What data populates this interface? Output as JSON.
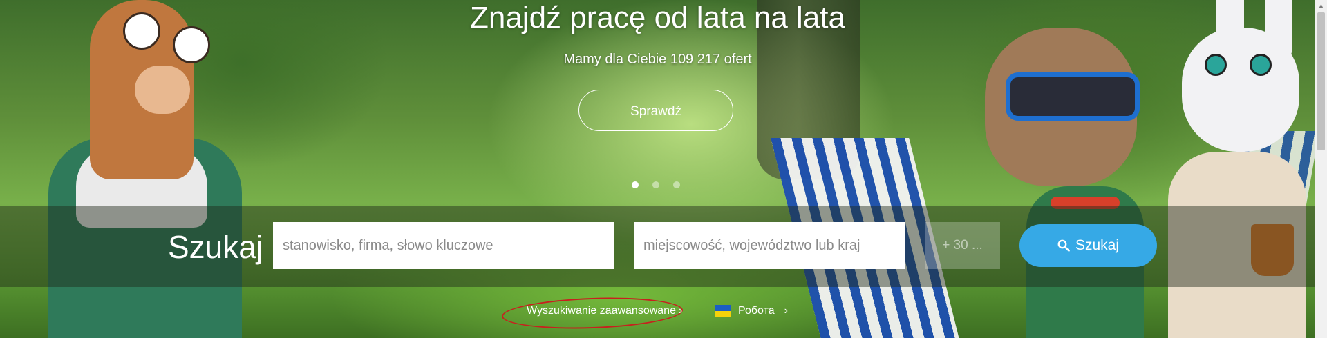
{
  "hero": {
    "headline": "Znajdź pracę od lata na lata",
    "subline": "Mamy dla Ciebie 109 217 ofert",
    "cta_label": "Sprawdź",
    "carousel": {
      "slide_count": 3,
      "active_index": 0
    }
  },
  "search": {
    "label": "Szukaj",
    "keyword_placeholder": "stanowisko, firma, słowo kluczowe",
    "location_placeholder": "miejscowość, województwo lub kraj",
    "radius_value": "+ 30 ...",
    "button_label": "Szukaj",
    "button_color": "#36a9e6"
  },
  "links": {
    "advanced_search": "Wyszukiwanie zaawansowane",
    "ukraine_jobs": "Робота",
    "ukraine_flag_colors": [
      "#1a5fc4",
      "#f4d20a"
    ]
  },
  "icons": {
    "search_button_icon": "search-icon",
    "chevron": "chevron-right-icon"
  }
}
